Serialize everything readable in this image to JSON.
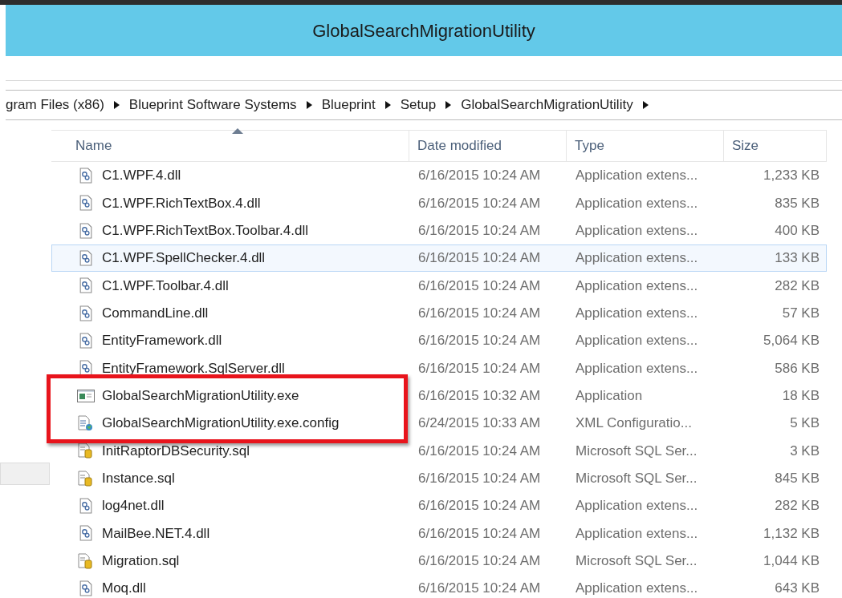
{
  "window": {
    "title": "GlobalSearchMigrationUtility"
  },
  "breadcrumb": [
    "gram Files (x86)",
    "Blueprint Software Systems",
    "Blueprint",
    "Setup",
    "GlobalSearchMigrationUtility"
  ],
  "table": {
    "columns": [
      {
        "label": "Name",
        "sorted": true
      },
      {
        "label": "Date modified",
        "sorted": false
      },
      {
        "label": "Type",
        "sorted": false
      },
      {
        "label": "Size",
        "sorted": false
      }
    ],
    "rows": [
      {
        "kind": "dll",
        "name": "C1.WPF.4.dll",
        "date": "6/16/2015 10:24 AM",
        "type": "Application extens...",
        "size": "1,233 KB",
        "hovered": false,
        "highlighted": false
      },
      {
        "kind": "dll",
        "name": "C1.WPF.RichTextBox.4.dll",
        "date": "6/16/2015 10:24 AM",
        "type": "Application extens...",
        "size": "835 KB",
        "hovered": false,
        "highlighted": false
      },
      {
        "kind": "dll",
        "name": "C1.WPF.RichTextBox.Toolbar.4.dll",
        "date": "6/16/2015 10:24 AM",
        "type": "Application extens...",
        "size": "400 KB",
        "hovered": false,
        "highlighted": false
      },
      {
        "kind": "dll",
        "name": "C1.WPF.SpellChecker.4.dll",
        "date": "6/16/2015 10:24 AM",
        "type": "Application extens...",
        "size": "133 KB",
        "hovered": true,
        "highlighted": false
      },
      {
        "kind": "dll",
        "name": "C1.WPF.Toolbar.4.dll",
        "date": "6/16/2015 10:24 AM",
        "type": "Application extens...",
        "size": "282 KB",
        "hovered": false,
        "highlighted": false
      },
      {
        "kind": "dll",
        "name": "CommandLine.dll",
        "date": "6/16/2015 10:24 AM",
        "type": "Application extens...",
        "size": "57 KB",
        "hovered": false,
        "highlighted": false
      },
      {
        "kind": "dll",
        "name": "EntityFramework.dll",
        "date": "6/16/2015 10:24 AM",
        "type": "Application extens...",
        "size": "5,064 KB",
        "hovered": false,
        "highlighted": false
      },
      {
        "kind": "dll",
        "name": "EntityFramework.SqlServer.dll",
        "date": "6/16/2015 10:24 AM",
        "type": "Application extens...",
        "size": "586 KB",
        "hovered": false,
        "highlighted": false
      },
      {
        "kind": "exe",
        "name": "GlobalSearchMigrationUtility.exe",
        "date": "6/16/2015 10:32 AM",
        "type": "Application",
        "size": "18 KB",
        "hovered": false,
        "highlighted": true
      },
      {
        "kind": "config",
        "name": "GlobalSearchMigrationUtility.exe.config",
        "date": "6/24/2015 10:33 AM",
        "type": "XML Configuratio...",
        "size": "5 KB",
        "hovered": false,
        "highlighted": true
      },
      {
        "kind": "sql",
        "name": "InitRaptorDBSecurity.sql",
        "date": "6/16/2015 10:24 AM",
        "type": "Microsoft SQL Ser...",
        "size": "3 KB",
        "hovered": false,
        "highlighted": false
      },
      {
        "kind": "sql",
        "name": "Instance.sql",
        "date": "6/16/2015 10:24 AM",
        "type": "Microsoft SQL Ser...",
        "size": "845 KB",
        "hovered": false,
        "highlighted": false
      },
      {
        "kind": "dll",
        "name": "log4net.dll",
        "date": "6/16/2015 10:24 AM",
        "type": "Application extens...",
        "size": "282 KB",
        "hovered": false,
        "highlighted": false
      },
      {
        "kind": "dll",
        "name": "MailBee.NET.4.dll",
        "date": "6/16/2015 10:24 AM",
        "type": "Application extens...",
        "size": "1,132 KB",
        "hovered": false,
        "highlighted": false
      },
      {
        "kind": "sql",
        "name": "Migration.sql",
        "date": "6/16/2015 10:24 AM",
        "type": "Microsoft SQL Ser...",
        "size": "1,044 KB",
        "hovered": false,
        "highlighted": false
      },
      {
        "kind": "dll",
        "name": "Moq.dll",
        "date": "6/16/2015 10:24 AM",
        "type": "Application extens...",
        "size": "643 KB",
        "hovered": false,
        "highlighted": false
      }
    ]
  }
}
